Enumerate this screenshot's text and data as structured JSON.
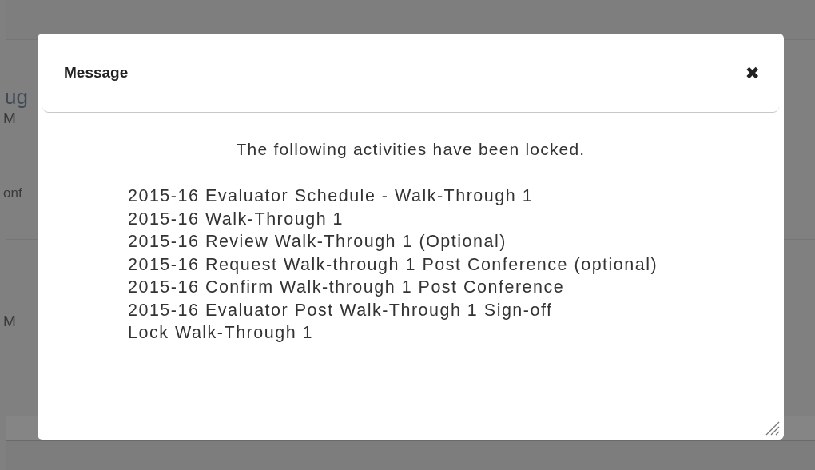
{
  "background_page": {
    "fragments": [
      "ug",
      "M",
      "onf",
      "M"
    ]
  },
  "dialog": {
    "title": "Message",
    "close_label": "✖",
    "message": "The following activities have been locked.",
    "activities": [
      "2015-16 Evaluator Schedule - Walk-Through 1",
      "2015-16 Walk-Through 1",
      "2015-16 Review Walk-Through 1 (Optional)",
      "2015-16 Request Walk-through 1 Post Conference (optional)",
      "2015-16 Confirm Walk-through 1 Post Conference",
      "2015-16 Evaluator Post Walk-Through 1 Sign-off",
      "Lock Walk-Through 1"
    ]
  }
}
